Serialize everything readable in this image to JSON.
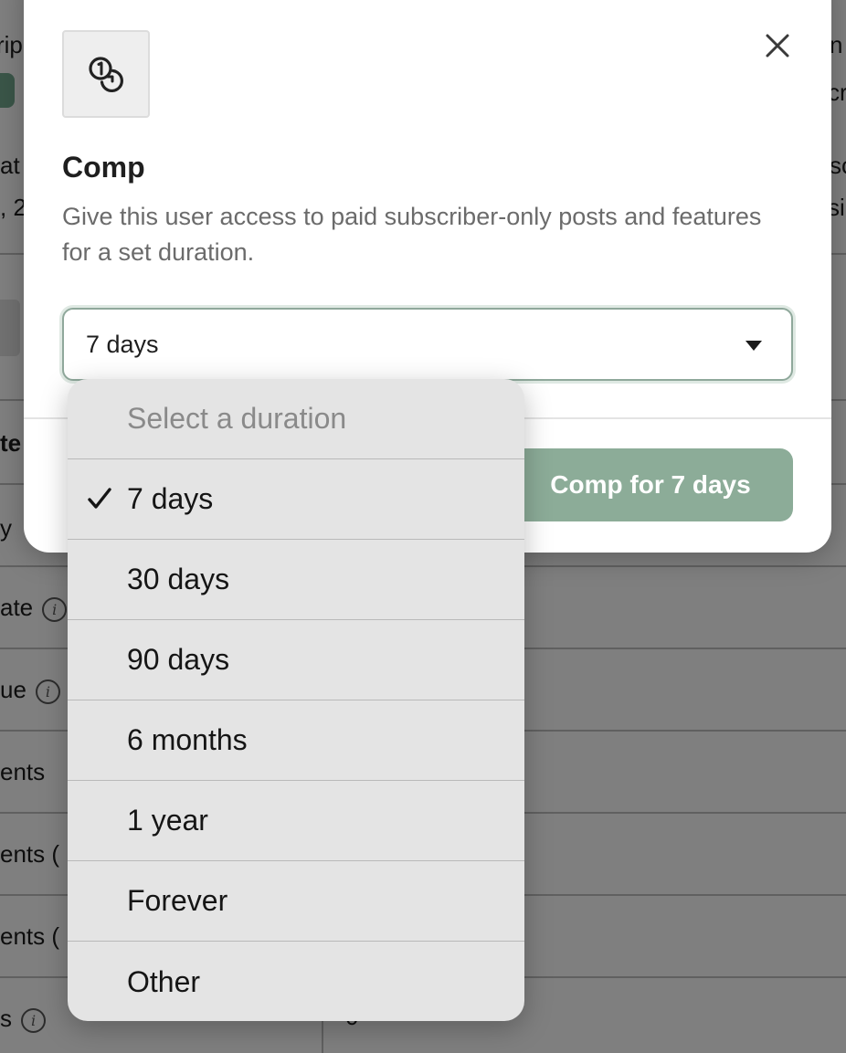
{
  "background": {
    "partial_labels": [
      "rip",
      "at",
      ", 2",
      "te",
      "y",
      "ate",
      "ue",
      "ents",
      "ents (",
      "ents (",
      "s",
      "n",
      "cr",
      "sc",
      "si",
      "0"
    ]
  },
  "modal": {
    "icon": "comp-coin-icon",
    "title": "Comp",
    "description": "Give this user access to paid subscriber-only posts and features for a set duration.",
    "select": {
      "value": "7 days"
    },
    "primary_button": "Comp for 7 days",
    "close_icon": "close-icon"
  },
  "dropdown": {
    "placeholder": "Select a duration",
    "selected_index": 0,
    "options": [
      "7 days",
      "30 days",
      "90 days",
      "6 months",
      "1 year",
      "Forever",
      "Other"
    ]
  },
  "colors": {
    "accent": "#8cac98",
    "focus_ring": "#8fa89b",
    "badge": "#6fa48a"
  }
}
